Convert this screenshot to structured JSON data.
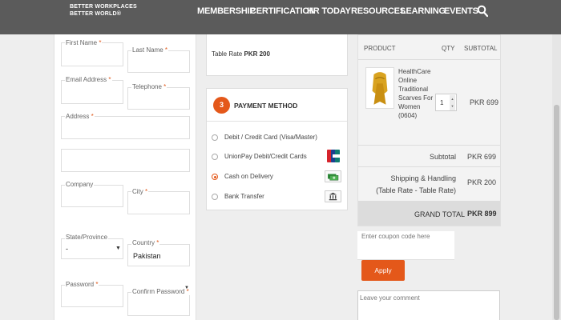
{
  "header": {
    "logo_line1": "BETTER WORKPLACES",
    "logo_line2": "BETTER WORLD®",
    "nav": [
      "MEMBERSHIP",
      "CERTIFICATION",
      "HR TODAY",
      "RESOURCES",
      "LEARNING",
      "EVENTS"
    ],
    "search_icon": "search-icon"
  },
  "form": {
    "first_name": "First Name",
    "last_name": "Last Name",
    "email": "Email Address",
    "telephone": "Telephone",
    "address": "Address",
    "company": "Company",
    "city": "City",
    "state": "State/Province",
    "state_value": "-",
    "country": "Country",
    "country_value": "Pakistan",
    "password": "Password",
    "confirm_password": "Confirm Password",
    "required_mark": "*"
  },
  "shipping": {
    "label": "Table Rate",
    "amount": "PKR 200"
  },
  "payment": {
    "step": "3",
    "title": "PAYMENT METHOD",
    "options": [
      {
        "label": "Debit / Credit Card (Visa/Master)",
        "icon": "",
        "checked": false
      },
      {
        "label": "UnionPay Debit/Credit Cards",
        "icon": "unionpay-icon",
        "checked": false
      },
      {
        "label": "Cash on Delivery",
        "icon": "cash-icon",
        "checked": true
      },
      {
        "label": "Bank Transfer",
        "icon": "bank-icon",
        "checked": false
      }
    ]
  },
  "summary": {
    "col_product": "PRODUCT",
    "col_qty": "QTY",
    "col_subtotal": "SUBTOTAL",
    "product_name": "HealthCare Online Traditional Scarves For Women (0604)",
    "product_qty": "1",
    "product_subtotal": "PKR 699",
    "subtotal_label": "Subtotal",
    "subtotal_value": "PKR 699",
    "shipping_label": "Shipping & Handling (Table Rate - Table Rate)",
    "shipping_value": "PKR 200",
    "grand_label": "GRAND TOTAL",
    "grand_value": "PKR 899"
  },
  "coupon": {
    "placeholder": "Enter coupon code here",
    "apply_label": "Apply"
  },
  "comment": {
    "placeholder": "Leave your comment"
  },
  "colors": {
    "accent": "#e4581a",
    "header_bg": "#5b5b5b"
  }
}
